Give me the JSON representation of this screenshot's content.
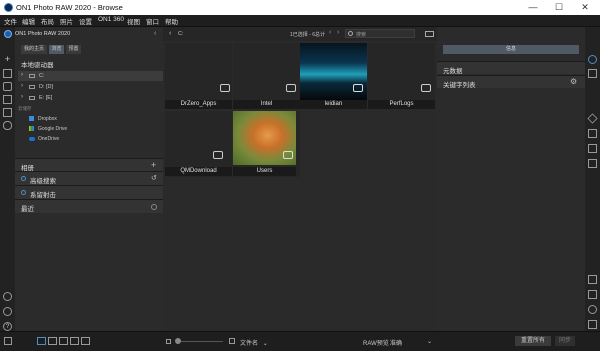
{
  "window": {
    "title": "ON1 Photo RAW 2020 - Browse",
    "minimize": "—",
    "maximize": "☐",
    "close": "✕"
  },
  "menu": [
    "文件",
    "编辑",
    "布局",
    "照片",
    "设置",
    "ON1 360",
    "视图",
    "窗口",
    "帮助"
  ],
  "left": {
    "app_name": "ON1 Photo RAW 2020",
    "tabs": [
      "我的主页",
      "浏览",
      "预置"
    ],
    "local_drives_title": "本地驱动器",
    "drives": [
      "C:",
      "D: [D]",
      "E: [E]"
    ],
    "cloud_title": "云储存",
    "cloud": [
      "Dropbox",
      "Google Drive",
      "OneDrive"
    ],
    "albums": "相册",
    "advanced_search": "高级搜索",
    "tethered": "系留射击",
    "recent": "最近"
  },
  "center": {
    "path": "C:",
    "selection": "1已选择 - 6总计",
    "search_placeholder": "搜索",
    "tiles": [
      {
        "label": "DrZero_Apps"
      },
      {
        "label": "Intel"
      },
      {
        "label": "leidian"
      },
      {
        "label": "PerfLogs"
      },
      {
        "label": "QMDownload"
      },
      {
        "label": "Users"
      }
    ]
  },
  "right": {
    "info_tab": "信息",
    "metadata": "元数据",
    "keywords": "关键字列表"
  },
  "bottom": {
    "file_name_label": "文件名",
    "raw_preview_label": "RAW预览",
    "raw_preview_value": "准确",
    "reset_all": "重置所有",
    "sync": "同步"
  },
  "colors": {
    "accent": "#4a90c8",
    "selected_tab": "#4f5a66",
    "panel": "#2b2b2b"
  }
}
